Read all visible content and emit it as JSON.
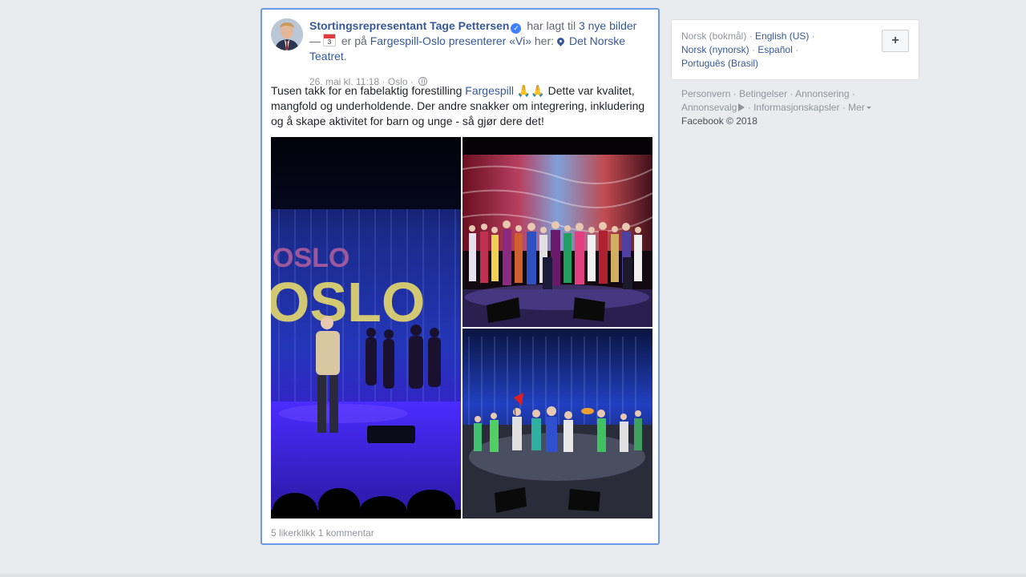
{
  "post": {
    "author": "Stortingsrepresentant Tage Pettersen",
    "action_text": "har lagt til",
    "photos_link": "3 nye bilder",
    "dash": "—",
    "calendar_day": "3",
    "at_text": "er på",
    "event_link": "Fargespill-Oslo presenterer «Vi»",
    "here_text": "her:",
    "place_link": "Det Norske Teatret",
    "place_suffix": ".",
    "timestamp": "26. mai kl. 11:18",
    "location": "Oslo",
    "body_before": "Tusen takk for en fabelaktig forestilling",
    "body_link": "Fargespill",
    "body_emoji": "🙏🙏",
    "body_after": "Dette var kvalitet, mangfold og underholdende. Der andre snakker om integrering, inkludering og å skape aktivitet for barn og unge - så gjør dere det!",
    "likes": "5 likerklikk",
    "comments": "1 kommentar",
    "stage_sign": "OSLO"
  },
  "languages": {
    "current": "Norsk (bokmål)",
    "items": [
      "English (US)",
      "Norsk (nynorsk)",
      "Español",
      "Português (Brasil)"
    ],
    "sep": "·",
    "add_label": "+"
  },
  "footer": {
    "links": [
      "Personvern",
      "Betingelser",
      "Annonsering",
      "Annonsevalg",
      "Informasjonskapsler",
      "Mer"
    ],
    "copyright": "Facebook © 2018"
  },
  "colors": {
    "link": "#365899",
    "focus_border": "#6d9ae8",
    "page_bg": "#e9ebee"
  }
}
